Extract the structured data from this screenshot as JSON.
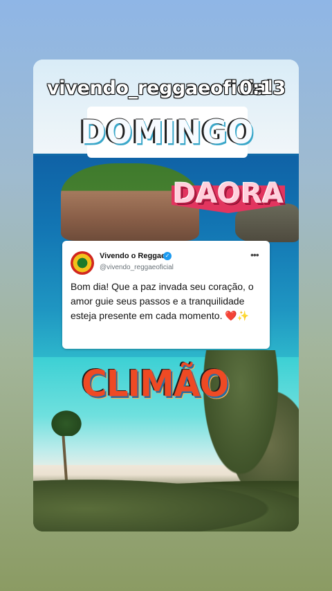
{
  "overlay": {
    "account": "vivendo_reggaeoficial",
    "timer": "0:13"
  },
  "stickers": {
    "top": "DOMINGO",
    "middle": "DAORA",
    "bottom": "CLIMÃO"
  },
  "tweet": {
    "name": "Vivendo o Reggae",
    "handle": "@vivendo_reggaeoficial",
    "text": "Bom dia! Que a paz invada seu coração, o amor guie seus passos e a tranquilidade esteja presente em cada momento. ❤️✨",
    "more_icon": "more-dots-icon",
    "verified_icon": "verified-badge-icon"
  },
  "colors": {
    "tweet_bg": "#ffffff",
    "daora_banner": "#e2355f",
    "climao_text": "#ee4a24",
    "verified": "#1d9bf0"
  }
}
